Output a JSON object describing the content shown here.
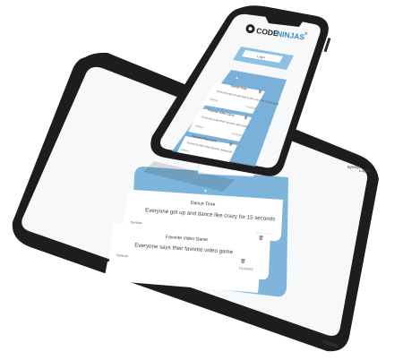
{
  "brand": {
    "logo_code": "CODE",
    "logo_ninjas": "NINJAS",
    "logo_mark": "®"
  },
  "phone": {
    "login_label": "Login",
    "cards": [
      {
        "title": "Dance Time",
        "body": "Everyone get up and dance like crazy for 15 seconds",
        "author": "ByNinja",
        "date": "7/14/2022"
      },
      {
        "title": "Favorite Video Game",
        "body": "Everyone says their favorite video game",
        "author": "ByNinja",
        "date": "7/14/2022"
      },
      {
        "title": "Favorite Restaurant",
        "body": "Everyone says their favorite restaurant",
        "author": "ByNinja"
      }
    ]
  },
  "tablet": {
    "header_user": "ByNinja",
    "logout_label": "Logout",
    "add_symbol": "+",
    "cards": [
      {
        "title": "Dance Time",
        "body": "Everyone get up and dance like crazy for 15 seconds",
        "author": "ByNinja",
        "date": "7/14/2022"
      },
      {
        "title": "Favorite Video Game",
        "body": "Everyone says their favorite video game",
        "author": "ByNinja",
        "date": "7/14/2022"
      }
    ]
  },
  "colors": {
    "device_frame": "#1d1d20",
    "panel_blue": "#6aa9d4",
    "card_white": "#ffffff",
    "screen_bg": "#f7f8fa"
  }
}
